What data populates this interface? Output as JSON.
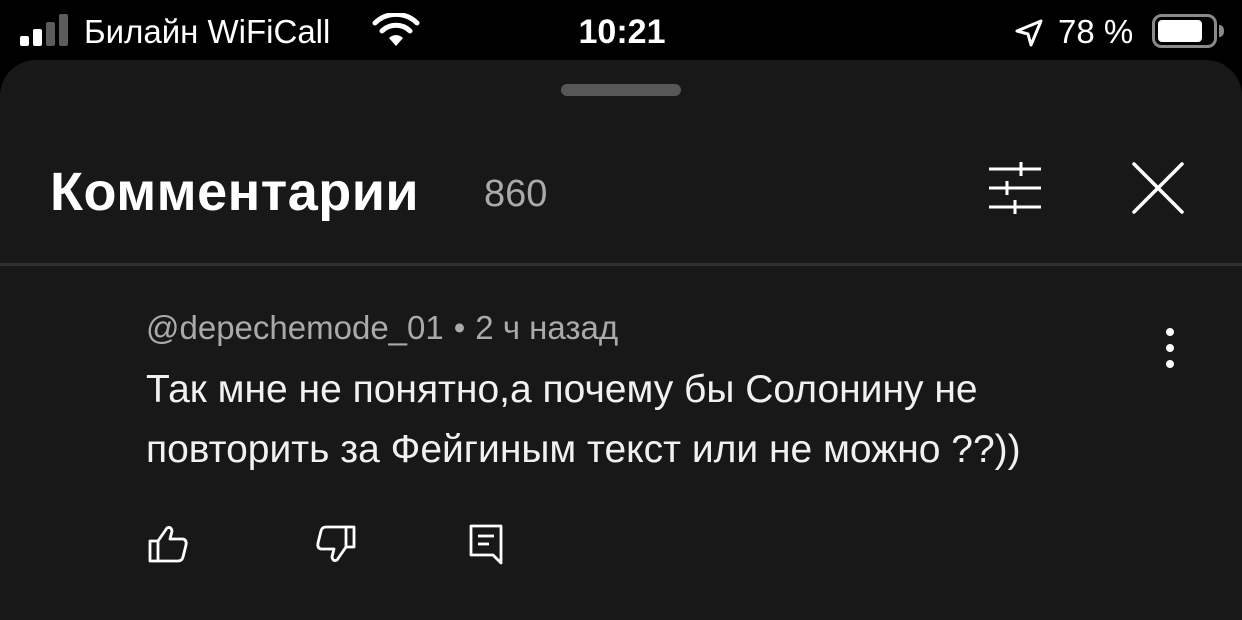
{
  "status_bar": {
    "carrier": "Билайн WiFiCall",
    "time": "10:21",
    "battery_percent": "78 %",
    "icons": [
      "signal-icon",
      "wifi-icon",
      "location-arrow-icon",
      "battery-icon"
    ]
  },
  "sheet": {
    "title": "Комментарии",
    "count": "860",
    "icons": [
      "filter-icon",
      "close-icon"
    ]
  },
  "comment": {
    "author": "@depechemode_01",
    "separator": "•",
    "time": "2 ч назад",
    "text": "Так мне не понятно,а почему бы Солонину не повторить за Фейгиным текст или не можно ??))",
    "icons": [
      "more-vert-icon",
      "thumb-up-icon",
      "thumb-down-icon",
      "reply-icon"
    ]
  },
  "colors": {
    "background": "#000000",
    "sheet": "#181818",
    "text_primary": "#ffffff",
    "text_secondary": "#aaaaaa",
    "divider": "#2f2f2f"
  }
}
